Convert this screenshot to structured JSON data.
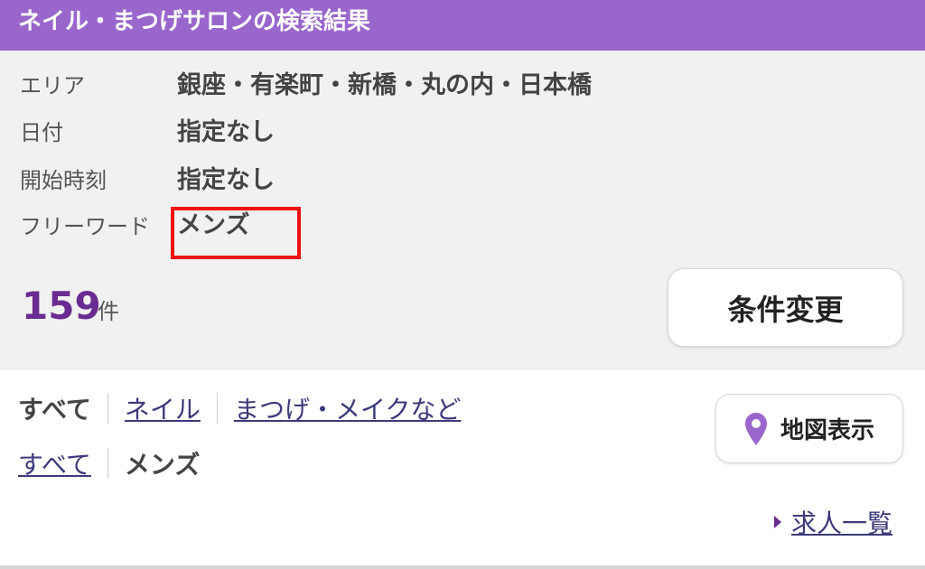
{
  "header": {
    "title": "ネイル・まつげサロンの検索結果"
  },
  "conditions": {
    "area_label": "エリア",
    "area_value": "銀座・有楽町・新橋・丸の内・日本橋",
    "date_label": "日付",
    "date_value": "指定なし",
    "time_label": "開始時刻",
    "time_value": "指定なし",
    "keyword_label": "フリーワード",
    "keyword_value": "メンズ"
  },
  "results": {
    "count": "159",
    "unit": "件"
  },
  "change_button": {
    "label": "条件変更"
  },
  "category_filter": {
    "current": "すべて",
    "links": [
      "ネイル",
      "まつげ・メイクなど"
    ]
  },
  "subcategory_filter": {
    "link": "すべて",
    "current": "メンズ"
  },
  "map_button": {
    "label": "地図表示",
    "icon": "map-pin-icon"
  },
  "jobs_link": {
    "label": "求人一覧",
    "icon": "caret-right-icon"
  },
  "colors": {
    "header_bg": "#9966cc",
    "accent": "#6a2c91",
    "link": "#3b3a7a",
    "highlight": "#ee1111",
    "panel_bg": "#f1f1f1"
  }
}
